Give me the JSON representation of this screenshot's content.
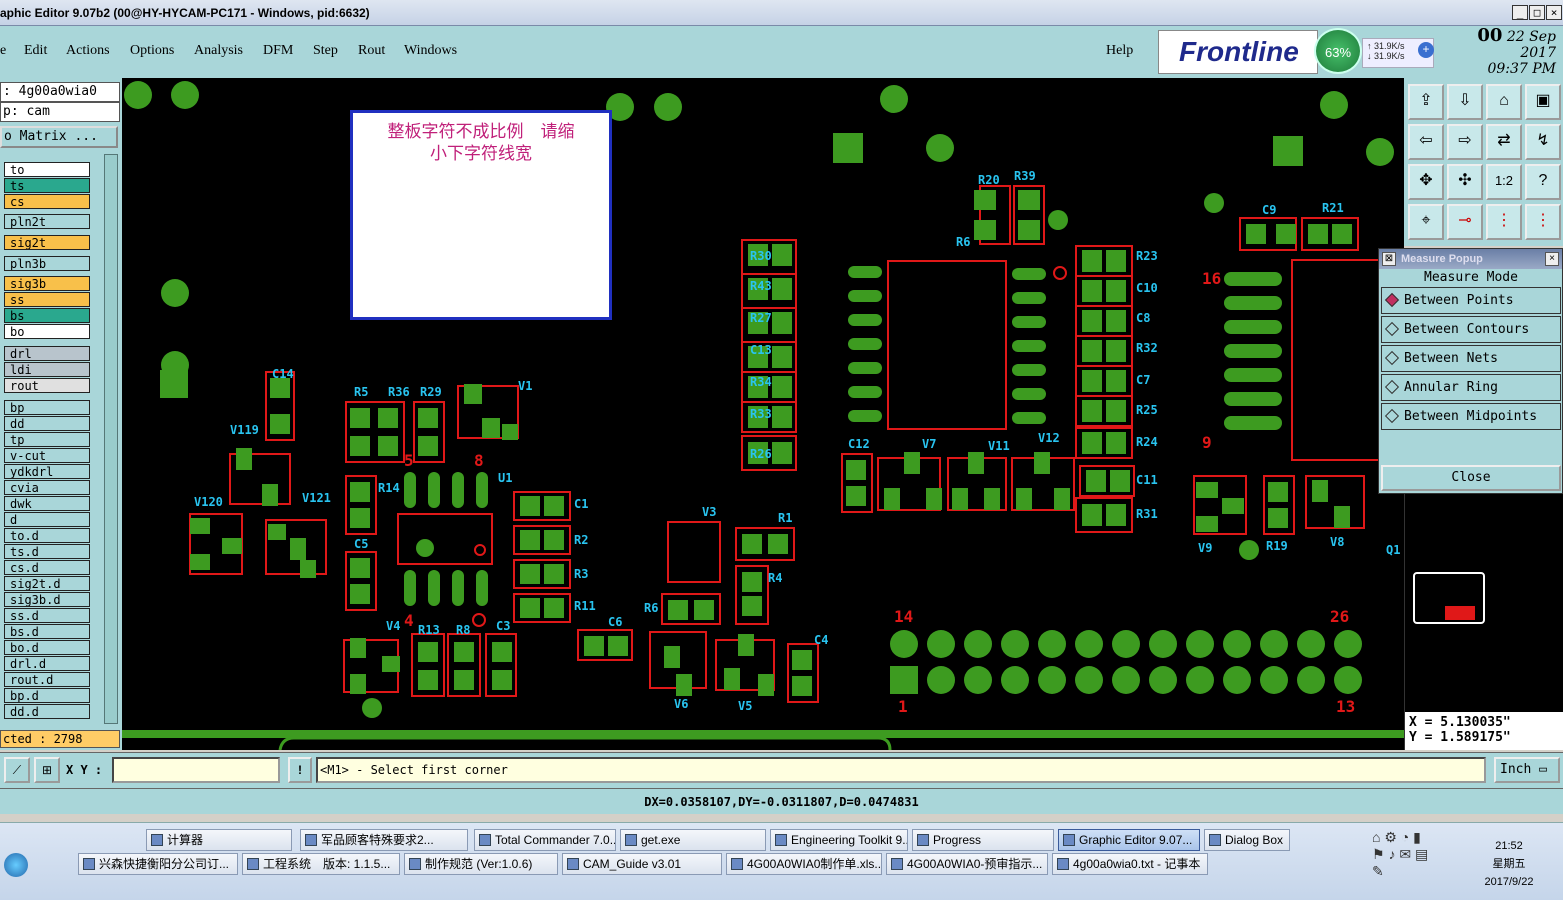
{
  "window": {
    "title": "aphic Editor 9.07b2 (00@HY-HYCAM-PC171 - Windows, pid:6632)"
  },
  "menu": {
    "items": [
      "e",
      "Edit",
      "Actions",
      "Options",
      "Analysis",
      "DFM",
      "Step",
      "Rout",
      "Windows"
    ],
    "help": "Help"
  },
  "brand": {
    "logo": "Frontline",
    "net_percent": "63%",
    "up_rate": "31.9K/s",
    "down_rate": "31.9K/s",
    "date": "22 Sep 2017",
    "time": "09:37 PM",
    "partial": "00"
  },
  "left": {
    "job": ": 4g00a0wia0",
    "step": "p: cam",
    "matrix": "o Matrix ...",
    "selected": "cted : 2798",
    "layers": [
      {
        "name": "to",
        "color": "#ffffff"
      },
      {
        "name": "ts",
        "color": "#2aa88e"
      },
      {
        "name": "cs",
        "color": "#f8c04a"
      },
      {
        "name": "pln2t",
        "color": "#a9d6d9"
      },
      {
        "name": "sig2t",
        "color": "#f8c04a"
      },
      {
        "name": "pln3b",
        "color": "#a9d6d9"
      },
      {
        "name": "sig3b",
        "color": "#f8c04a"
      },
      {
        "name": "ss",
        "color": "#f8c04a"
      },
      {
        "name": "bs",
        "color": "#2aa88e"
      },
      {
        "name": "bo",
        "color": "#ffffff"
      },
      {
        "name": "drl",
        "color": "#b8c4cc"
      },
      {
        "name": "ldi",
        "color": "#b8c4cc"
      },
      {
        "name": "rout",
        "color": "#e0e0e0"
      },
      {
        "name": "bp",
        "color": "#a9d6d9"
      },
      {
        "name": "dd",
        "color": "#a9d6d9"
      },
      {
        "name": "tp",
        "color": "#a9d6d9"
      },
      {
        "name": "v-cut",
        "color": "#a9d6d9"
      },
      {
        "name": "ydkdrl",
        "color": "#a9d6d9"
      },
      {
        "name": "cvia",
        "color": "#a9d6d9"
      },
      {
        "name": "dwk",
        "color": "#a9d6d9"
      },
      {
        "name": "d",
        "color": "#a9d6d9"
      },
      {
        "name": "to.d",
        "color": "#a9d6d9"
      },
      {
        "name": "ts.d",
        "color": "#a9d6d9"
      },
      {
        "name": "cs.d",
        "color": "#a9d6d9"
      },
      {
        "name": "sig2t.d",
        "color": "#a9d6d9"
      },
      {
        "name": "sig3b.d",
        "color": "#a9d6d9"
      },
      {
        "name": "ss.d",
        "color": "#a9d6d9"
      },
      {
        "name": "bs.d",
        "color": "#a9d6d9"
      },
      {
        "name": "bo.d",
        "color": "#a9d6d9"
      },
      {
        "name": "drl.d",
        "color": "#a9d6d9"
      },
      {
        "name": "rout.d",
        "color": "#a9d6d9"
      },
      {
        "name": "bp.d",
        "color": "#a9d6d9"
      },
      {
        "name": "dd.d",
        "color": "#a9d6d9"
      }
    ]
  },
  "canvas": {
    "note_line1": "整板字符不成比例　请缩",
    "note_line2": "小下字符线宽"
  },
  "measure": {
    "title": "Measure Popup",
    "mode_label": "Measure Mode",
    "options": [
      "Between Points",
      "Between Contours",
      "Between Nets",
      "Annular Ring",
      "Between Midpoints"
    ],
    "selected": "Between Points",
    "close": "Close"
  },
  "coords": {
    "x": "X = 5.130035\"",
    "y": "Y = 1.589175\""
  },
  "cmd": {
    "xy_label": "X Y :",
    "xy_value": "",
    "prompt": "<M1> - Select first corner",
    "unit": "Inch"
  },
  "status": {
    "text": "DX=0.0358107,DY=-0.0311807,D=0.0474831"
  },
  "taskbar": {
    "row1": [
      "计算器",
      "军品顾客特殊要求2...",
      "Total Commander 7.0...",
      "get.exe",
      "Engineering Toolkit 9....",
      "Progress",
      "Graphic Editor 9.07...",
      "Dialog Box"
    ],
    "row2": [
      "兴森快捷衡阳分公司订...",
      "工程系统　版本: 1.1.5...",
      "制作规范 (Ver:1.0.6)",
      "CAM_Guide v3.01",
      "4G00A0WIA0制作单.xls...",
      "4G00A0WIA0-预审指示...",
      "4g00a0wia0.txt - 记事本"
    ],
    "active": "Graphic Editor 9.07...",
    "clock_time": "21:52",
    "clock_day": "星期五",
    "clock_date": "2017/9/22"
  }
}
